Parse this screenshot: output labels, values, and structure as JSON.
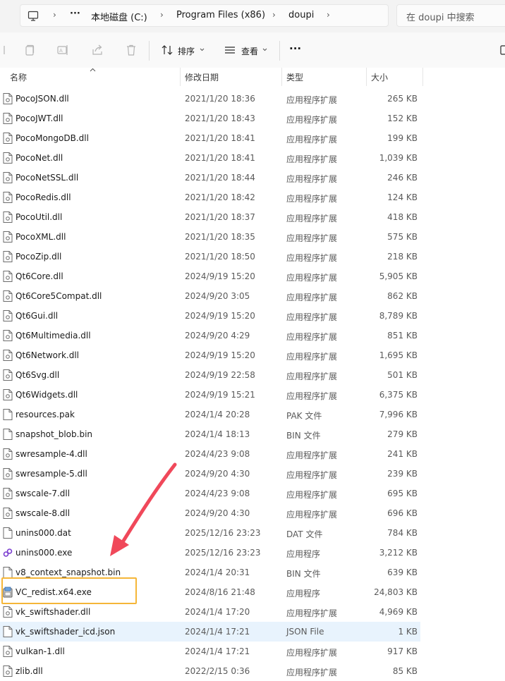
{
  "address_bar": {
    "crumbs": [
      "本地磁盘 (C:)",
      "Program Files (x86)",
      "doupi"
    ],
    "overflow": "···",
    "search_placeholder": "在 doupi 中搜索"
  },
  "toolbar": {
    "sort_label": "排序",
    "view_label": "查看",
    "more_label": "···"
  },
  "columns": {
    "name": "名称",
    "modified": "修改日期",
    "type": "类型",
    "size": "大小"
  },
  "files": [
    {
      "name": "PocoJSON.dll",
      "date": "2021/1/20 18:36",
      "type": "应用程序扩展",
      "size": "265 KB",
      "icon": "dll-file-icon"
    },
    {
      "name": "PocoJWT.dll",
      "date": "2021/1/20 18:43",
      "type": "应用程序扩展",
      "size": "152 KB",
      "icon": "dll-file-icon"
    },
    {
      "name": "PocoMongoDB.dll",
      "date": "2021/1/20 18:41",
      "type": "应用程序扩展",
      "size": "199 KB",
      "icon": "dll-file-icon"
    },
    {
      "name": "PocoNet.dll",
      "date": "2021/1/20 18:41",
      "type": "应用程序扩展",
      "size": "1,039 KB",
      "icon": "dll-file-icon"
    },
    {
      "name": "PocoNetSSL.dll",
      "date": "2021/1/20 18:44",
      "type": "应用程序扩展",
      "size": "246 KB",
      "icon": "dll-file-icon"
    },
    {
      "name": "PocoRedis.dll",
      "date": "2021/1/20 18:42",
      "type": "应用程序扩展",
      "size": "124 KB",
      "icon": "dll-file-icon"
    },
    {
      "name": "PocoUtil.dll",
      "date": "2021/1/20 18:37",
      "type": "应用程序扩展",
      "size": "418 KB",
      "icon": "dll-file-icon"
    },
    {
      "name": "PocoXML.dll",
      "date": "2021/1/20 18:35",
      "type": "应用程序扩展",
      "size": "575 KB",
      "icon": "dll-file-icon"
    },
    {
      "name": "PocoZip.dll",
      "date": "2021/1/20 18:50",
      "type": "应用程序扩展",
      "size": "218 KB",
      "icon": "dll-file-icon"
    },
    {
      "name": "Qt6Core.dll",
      "date": "2024/9/19 15:20",
      "type": "应用程序扩展",
      "size": "5,905 KB",
      "icon": "dll-file-icon"
    },
    {
      "name": "Qt6Core5Compat.dll",
      "date": "2024/9/20 3:05",
      "type": "应用程序扩展",
      "size": "862 KB",
      "icon": "dll-file-icon"
    },
    {
      "name": "Qt6Gui.dll",
      "date": "2024/9/19 15:20",
      "type": "应用程序扩展",
      "size": "8,789 KB",
      "icon": "dll-file-icon"
    },
    {
      "name": "Qt6Multimedia.dll",
      "date": "2024/9/20 4:29",
      "type": "应用程序扩展",
      "size": "851 KB",
      "icon": "dll-file-icon"
    },
    {
      "name": "Qt6Network.dll",
      "date": "2024/9/19 15:20",
      "type": "应用程序扩展",
      "size": "1,695 KB",
      "icon": "dll-file-icon"
    },
    {
      "name": "Qt6Svg.dll",
      "date": "2024/9/19 22:58",
      "type": "应用程序扩展",
      "size": "501 KB",
      "icon": "dll-file-icon"
    },
    {
      "name": "Qt6Widgets.dll",
      "date": "2024/9/19 15:21",
      "type": "应用程序扩展",
      "size": "6,375 KB",
      "icon": "dll-file-icon"
    },
    {
      "name": "resources.pak",
      "date": "2024/1/4 20:28",
      "type": "PAK 文件",
      "size": "7,996 KB",
      "icon": "blank-file-icon"
    },
    {
      "name": "snapshot_blob.bin",
      "date": "2024/1/4 18:13",
      "type": "BIN 文件",
      "size": "279 KB",
      "icon": "blank-file-icon"
    },
    {
      "name": "swresample-4.dll",
      "date": "2024/4/23 9:08",
      "type": "应用程序扩展",
      "size": "241 KB",
      "icon": "dll-file-icon"
    },
    {
      "name": "swresample-5.dll",
      "date": "2024/9/20 4:30",
      "type": "应用程序扩展",
      "size": "239 KB",
      "icon": "dll-file-icon"
    },
    {
      "name": "swscale-7.dll",
      "date": "2024/4/23 9:08",
      "type": "应用程序扩展",
      "size": "695 KB",
      "icon": "dll-file-icon"
    },
    {
      "name": "swscale-8.dll",
      "date": "2024/9/20 4:30",
      "type": "应用程序扩展",
      "size": "696 KB",
      "icon": "dll-file-icon"
    },
    {
      "name": "unins000.dat",
      "date": "2025/12/16 23:23",
      "type": "DAT 文件",
      "size": "784 KB",
      "icon": "blank-file-icon"
    },
    {
      "name": "unins000.exe",
      "date": "2025/12/16 23:23",
      "type": "应用程序",
      "size": "3,212 KB",
      "icon": "uninstaller-icon"
    },
    {
      "name": "v8_context_snapshot.bin",
      "date": "2024/1/4 20:31",
      "type": "BIN 文件",
      "size": "639 KB",
      "icon": "blank-file-icon"
    },
    {
      "name": "VC_redist.x64.exe",
      "date": "2024/8/16 21:48",
      "type": "应用程序",
      "size": "24,803 KB",
      "icon": "installer-icon"
    },
    {
      "name": "vk_swiftshader.dll",
      "date": "2024/1/4 17:20",
      "type": "应用程序扩展",
      "size": "4,969 KB",
      "icon": "dll-file-icon"
    },
    {
      "name": "vk_swiftshader_icd.json",
      "date": "2024/1/4 17:21",
      "type": "JSON File",
      "size": "1 KB",
      "icon": "blank-file-icon"
    },
    {
      "name": "vulkan-1.dll",
      "date": "2024/1/4 17:21",
      "type": "应用程序扩展",
      "size": "917 KB",
      "icon": "dll-file-icon"
    },
    {
      "name": "zlib.dll",
      "date": "2022/2/15 0:36",
      "type": "应用程序扩展",
      "size": "85 KB",
      "icon": "dll-file-icon"
    }
  ],
  "colors": {
    "highlight_border": "#f5b638",
    "arrow": "#f0485a",
    "hover_row": "#e8f3fd"
  }
}
